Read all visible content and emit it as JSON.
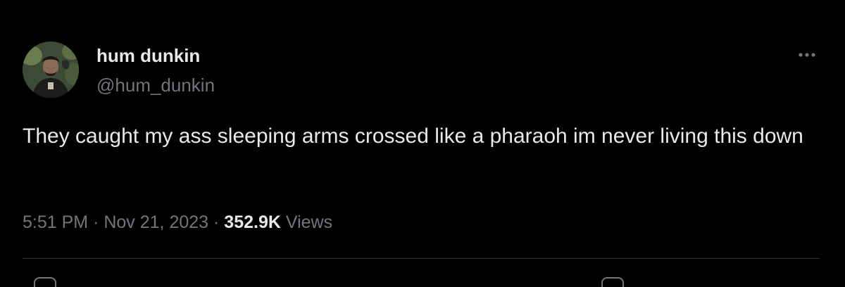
{
  "tweet": {
    "display_name": "hum dunkin",
    "handle": "@hum_dunkin",
    "text": "They caught my ass sleeping arms crossed like a pharaoh im never living this down",
    "time": "5:51 PM",
    "date": "Nov 21, 2023",
    "views_count": "352.9K",
    "views_label": "Views",
    "separator": "·"
  },
  "icons": {
    "more": "more-options-icon",
    "reply": "reply-icon",
    "share": "share-icon"
  },
  "colors": {
    "background": "#000000",
    "text_primary": "#e7e9ea",
    "text_secondary": "#71767b",
    "divider": "#2f3336"
  }
}
